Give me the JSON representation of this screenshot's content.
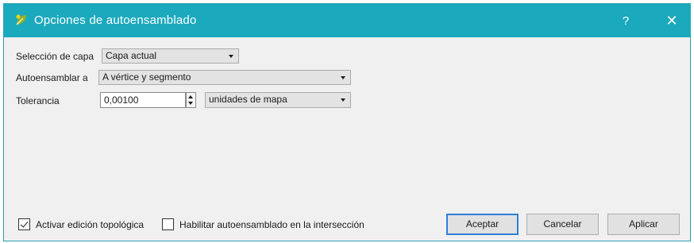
{
  "window": {
    "title": "Opciones de autoensamblado",
    "help_label": "?",
    "close_label": "✕"
  },
  "icons": {
    "app": "qgis-leaf-icon",
    "help": "help-icon",
    "close": "close-icon",
    "dropdown": "chevron-down-icon",
    "spin": "spinner-arrows-icon",
    "check": "checkmark-icon"
  },
  "colors": {
    "titlebar": "#1ba9bd",
    "dialog_bg": "#f0f0f0",
    "default_button_border": "#2f7fd9"
  },
  "form": {
    "layer_selection_label": "Selección de capa",
    "layer_selection_value": "Capa actual",
    "snap_to_label": "Autoensamblar a",
    "snap_to_value": "A vértice y segmento",
    "tolerance_label": "Tolerancia",
    "tolerance_value": "0,00100",
    "units_value": "unidades de mapa"
  },
  "options": {
    "topological_editing_label": "Activar edición topológica",
    "topological_editing_checked": true,
    "snap_intersection_label": "Habilitar autoensamblado en la intersección",
    "snap_intersection_checked": false
  },
  "buttons": {
    "accept": "Aceptar",
    "cancel": "Cancelar",
    "apply": "Aplicar"
  }
}
